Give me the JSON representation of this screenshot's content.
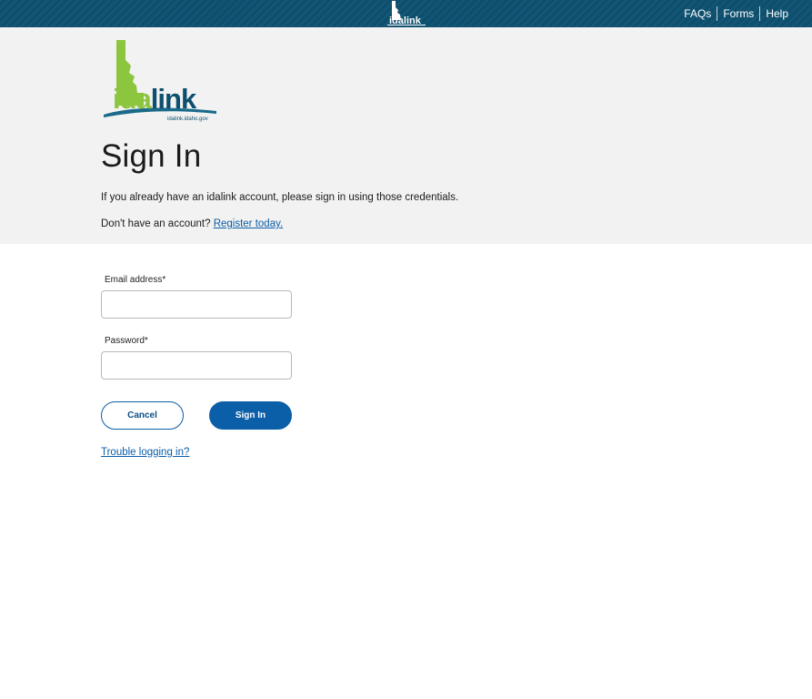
{
  "header": {
    "logo_text": "idalink",
    "nav": [
      {
        "label": "FAQs"
      },
      {
        "label": "Forms"
      },
      {
        "label": "Help"
      }
    ]
  },
  "brand": {
    "logo_text": "idalink",
    "logo_url_text": "idalink.idaho.gov"
  },
  "page": {
    "title": "Sign In",
    "intro": "If you already have an idalink account, please sign in using those credentials.",
    "no_account_text": "Don't have an account?",
    "register_link": "Register today."
  },
  "form": {
    "email_label": "Email address*",
    "email_value": "",
    "password_label": "Password*",
    "password_value": "",
    "cancel_label": "Cancel",
    "signin_label": "Sign In",
    "trouble_link": "Trouble logging in?"
  },
  "colors": {
    "topbar": "#0d4f6e",
    "hero_bg": "#f2f2f2",
    "primary": "#0b5ea8",
    "logo_green": "#8cc63f",
    "logo_blue": "#0d4f6e"
  }
}
